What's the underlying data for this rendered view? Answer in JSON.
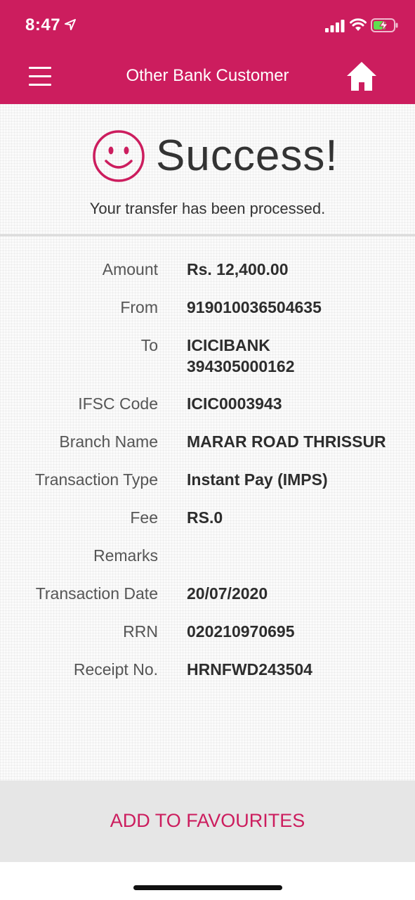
{
  "status_bar": {
    "time": "8:47"
  },
  "header": {
    "title": "Other Bank Customer"
  },
  "result": {
    "title": "Success!",
    "message": "Your transfer has been processed."
  },
  "details": [
    {
      "label": "Amount",
      "value": "Rs. 12,400.00"
    },
    {
      "label": "From",
      "value": "919010036504635"
    },
    {
      "label": "To",
      "value": "ICICIBANK",
      "value2": "394305000162"
    },
    {
      "label": "IFSC Code",
      "value": "ICIC0003943"
    },
    {
      "label": "Branch Name",
      "value": "MARAR ROAD THRISSUR"
    },
    {
      "label": "Transaction Type",
      "value": "Instant Pay (IMPS)"
    },
    {
      "label": "Fee",
      "value": "RS.0"
    },
    {
      "label": "Remarks",
      "value": ""
    },
    {
      "label": "Transaction Date",
      "value": "20/07/2020"
    },
    {
      "label": "RRN",
      "value": "020210970695"
    },
    {
      "label": "Receipt No.",
      "value": "HRNFWD243504"
    }
  ],
  "footer": {
    "button_label": "ADD TO FAVOURITES"
  },
  "colors": {
    "brand": "#cc1d5e",
    "footer_bg": "#e6e6e6"
  },
  "icons": [
    "location-arrow-icon",
    "signal-icon",
    "wifi-icon",
    "battery-charging-icon",
    "menu-icon",
    "home-icon",
    "smiley-icon"
  ]
}
